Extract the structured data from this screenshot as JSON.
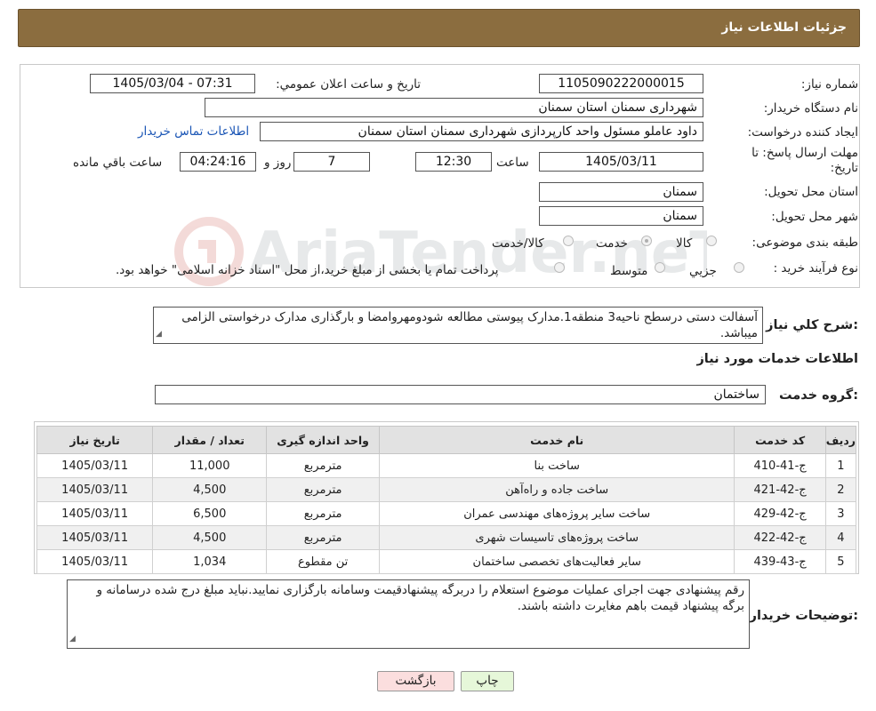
{
  "header": {
    "title": "جزئیات اطلاعات نیاز"
  },
  "form": {
    "need_number_label": "شماره نیاز:",
    "need_number": "1105090222000015",
    "announce_label": "تاريخ و ساعت اعلان عمومي:",
    "announce_value": "1405/03/04 - 07:31",
    "buyer_org_label": "نام دستگاه خريدار:",
    "buyer_org": "شهرداری سمنان استان سمنان",
    "requester_label": "ايجاد کننده درخواست:",
    "requester": "داود عاملو مسئول واحد کارپردازی شهرداری سمنان استان سمنان",
    "buyer_contact_link": "اطلاعات تماس خريدار",
    "deadline_label_1": "مهلت ارسال پاسخ: تا",
    "deadline_label_2": "تاريخ:",
    "deadline_date": "1405/03/11",
    "time_label": "ساعت",
    "deadline_time": "12:30",
    "days": "7",
    "days_label": "روز و",
    "remaining_time": "04:24:16",
    "remaining_label": "ساعت باقي مانده",
    "province_label": "استان محل تحویل:",
    "province": "سمنان",
    "city_label": "شهر محل تحویل:",
    "city": "سمنان",
    "category_label": "طبقه بندی موضوعی:",
    "category_options": [
      "کالا",
      "خدمت",
      "کالا/خدمت"
    ],
    "category_selected": "خدمت",
    "process_label": "نوع فرآیند خرید :",
    "process_options": [
      "جزيي",
      "متوسط"
    ],
    "process_note": "پرداخت تمام يا بخشی از مبلغ خريد،از محل \"اسناد خزانه اسلامی\" خواهد بود."
  },
  "description": {
    "label": "شرح کلي نياز:",
    "text": "آسفالت دستی درسطح ناحیه3 منطقه1.مدارک پیوستی مطالعه شودومهروامضا و بارگذاری مدارک درخواستی الزامی میباشد."
  },
  "services": {
    "section_title": "اطلاعات خدمات مورد نياز",
    "group_label": "گروه خدمت:",
    "group_value": "ساختمان",
    "columns": [
      "رديف",
      "کد خدمت",
      "نام خدمت",
      "واحد اندازه گيری",
      "تعداد / مقدار",
      "تاريخ نياز"
    ],
    "rows": [
      [
        "1",
        "ج-41-410",
        "ساخت بنا",
        "مترمربع",
        "11,000",
        "1405/03/11"
      ],
      [
        "2",
        "ج-42-421",
        "ساخت جاده و راه‌آهن",
        "مترمربع",
        "4,500",
        "1405/03/11"
      ],
      [
        "3",
        "ج-42-429",
        "ساخت ساير پروژه‌های مهندسی عمران",
        "مترمربع",
        "6,500",
        "1405/03/11"
      ],
      [
        "4",
        "ج-42-422",
        "ساخت پروژه‌های تاسيسات شهری",
        "مترمربع",
        "4,500",
        "1405/03/11"
      ],
      [
        "5",
        "ج-43-439",
        "ساير فعاليت‌های تخصصی ساختمان",
        "تن مقطوع",
        "1,034",
        "1405/03/11"
      ]
    ]
  },
  "buyer_notes": {
    "label": "توضيحات خريدار:",
    "text": "رقم پیشنهادی جهت اجرای عملیات موضوع استعلام را دربرگه پیشنهادقیمت وسامانه بارگزاری نمایید.نباید مبلغ درج شده درسامانه و برگه پیشنهاد قیمت باهم مغایرت داشته باشند."
  },
  "buttons": {
    "print": "چاپ",
    "back": "بازگشت"
  },
  "watermark": {
    "text": "AriaTender.neT"
  },
  "colors": {
    "header_bg": "#8b6d3f",
    "link": "#1a55b5",
    "back_btn_bg": "#fbdede",
    "print_btn_bg": "#e6f7d9"
  }
}
